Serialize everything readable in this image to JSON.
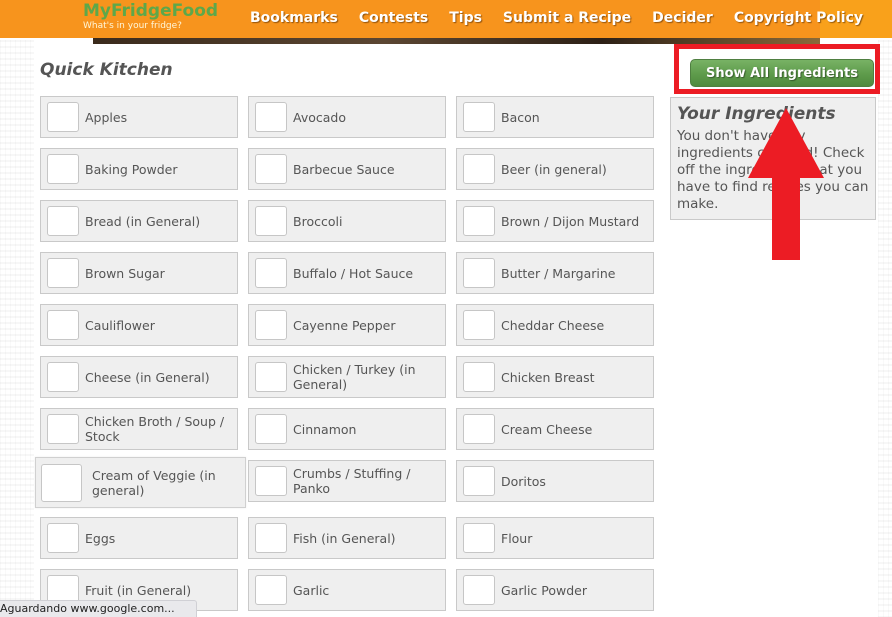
{
  "header": {
    "logo_title": "MyFridgeFood",
    "logo_subtitle": "What's in your fridge?",
    "nav": [
      "Bookmarks",
      "Contests",
      "Tips",
      "Submit a Recipe",
      "Decider",
      "Copyright Policy"
    ]
  },
  "main": {
    "title": "Quick Kitchen",
    "ingredients": [
      "Apples",
      "Avocado",
      "Bacon",
      "Baking Powder",
      "Barbecue Sauce",
      "Beer (in general)",
      "Bread (in General)",
      "Broccoli",
      "Brown / Dijon Mustard",
      "Brown Sugar",
      "Buffalo / Hot Sauce",
      "Butter / Margarine",
      "Cauliflower",
      "Cayenne Pepper",
      "Cheddar Cheese",
      "Cheese (in General)",
      "Chicken / Turkey (in General)",
      "Chicken Breast",
      "Chicken Broth / Soup / Stock",
      "Cinnamon",
      "Cream Cheese",
      "Cream of Veggie (in general)",
      "Crumbs / Stuffing / Panko",
      "Doritos",
      "Eggs",
      "Fish (in General)",
      "Flour",
      "Fruit (in General)",
      "Garlic",
      "Garlic Powder"
    ],
    "hovered_index": 21
  },
  "sidebar": {
    "show_all_button": "Show All Ingredients",
    "your_ingredients_title": "Your Ingredients",
    "your_ingredients_text": "You don't have any ingredients checked! Check off the ingredients that you have to find recipes you can make."
  },
  "annotation": {
    "highlight_color": "#ec1c24",
    "arrow_color": "#ec1c24"
  },
  "status_bar": {
    "text": "Aguardando www.google.com..."
  }
}
